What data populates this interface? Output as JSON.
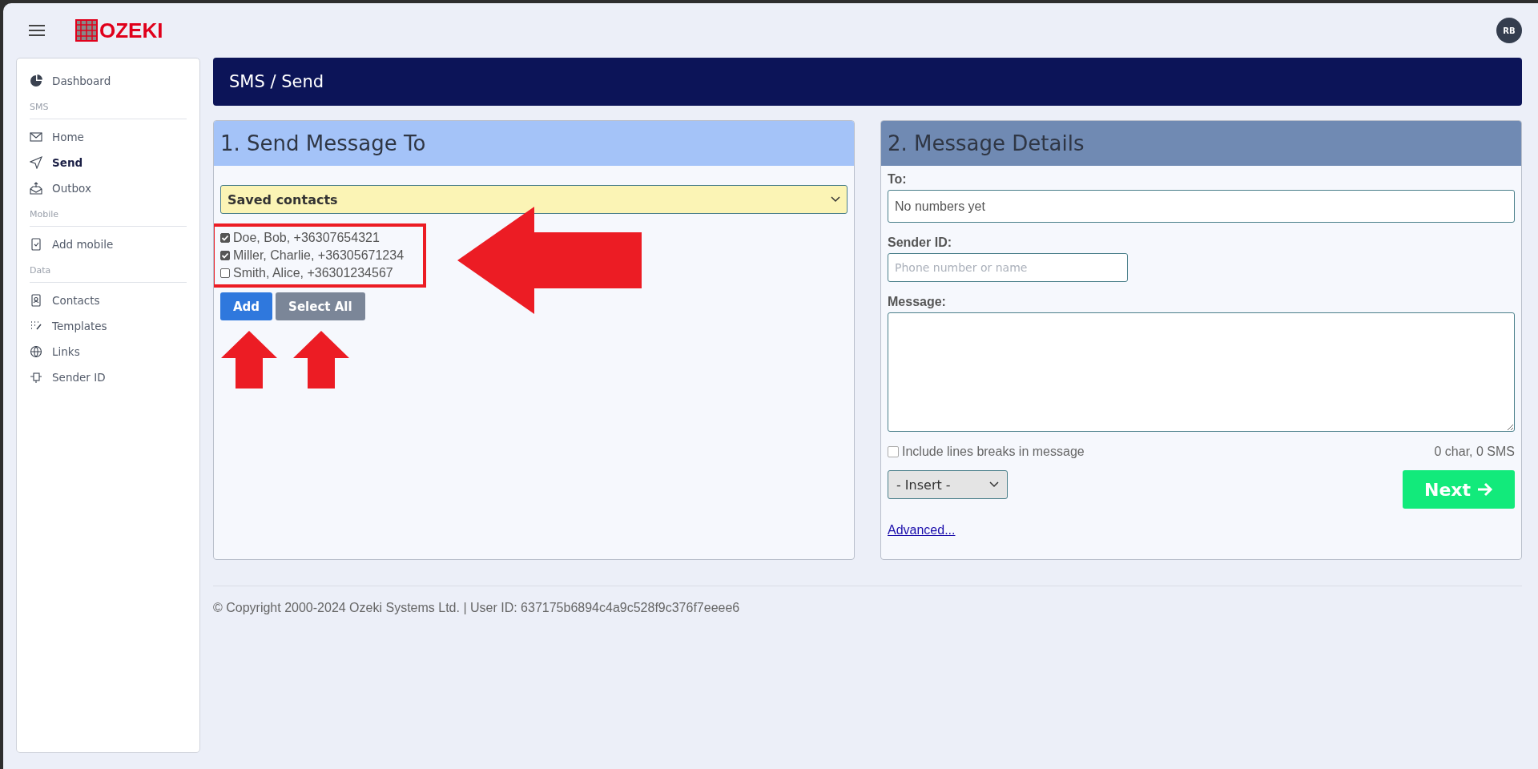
{
  "header": {
    "logo": "OZEKI",
    "avatar": "RB"
  },
  "sidebar": {
    "items": [
      {
        "label": "Dashboard",
        "selected": false
      }
    ],
    "sections": [
      {
        "title": "SMS",
        "items": [
          {
            "label": "Home",
            "selected": false
          },
          {
            "label": "Send",
            "selected": true
          },
          {
            "label": "Outbox",
            "selected": false
          }
        ]
      },
      {
        "title": "Mobile",
        "items": [
          {
            "label": "Add mobile",
            "selected": false
          }
        ]
      },
      {
        "title": "Data",
        "items": [
          {
            "label": "Contacts",
            "selected": false
          },
          {
            "label": "Templates",
            "selected": false
          },
          {
            "label": "Links",
            "selected": false
          },
          {
            "label": "Sender ID",
            "selected": false
          }
        ]
      }
    ]
  },
  "page_title": "SMS / Send",
  "send_to": {
    "title": "1. Send Message To",
    "source_select": "Saved contacts",
    "contacts": [
      {
        "label": "Doe, Bob, +36307654321",
        "checked": true
      },
      {
        "label": "Miller, Charlie, +36305671234",
        "checked": true
      },
      {
        "label": "Smith, Alice, +36301234567",
        "checked": false
      }
    ],
    "buttons": [
      "Add",
      "Select All"
    ]
  },
  "details": {
    "title": "2. Message Details",
    "to_label": "To:",
    "to_value": "No numbers yet",
    "sender_label": "Sender ID:",
    "sender_placeholder": "Phone number or name",
    "message_label": "Message:",
    "line_breaks": {
      "label": "Include lines breaks in message",
      "checked": false
    },
    "counter": "0 char, 0 SMS",
    "insert_select": "- Insert -",
    "next_button": "Next",
    "advanced_link": "Advanced..."
  },
  "footer": "© Copyright 2000-2024 Ozeki Systems Ltd. | User ID: 637175b6894c4a9c528f9c376f7eeee6"
}
